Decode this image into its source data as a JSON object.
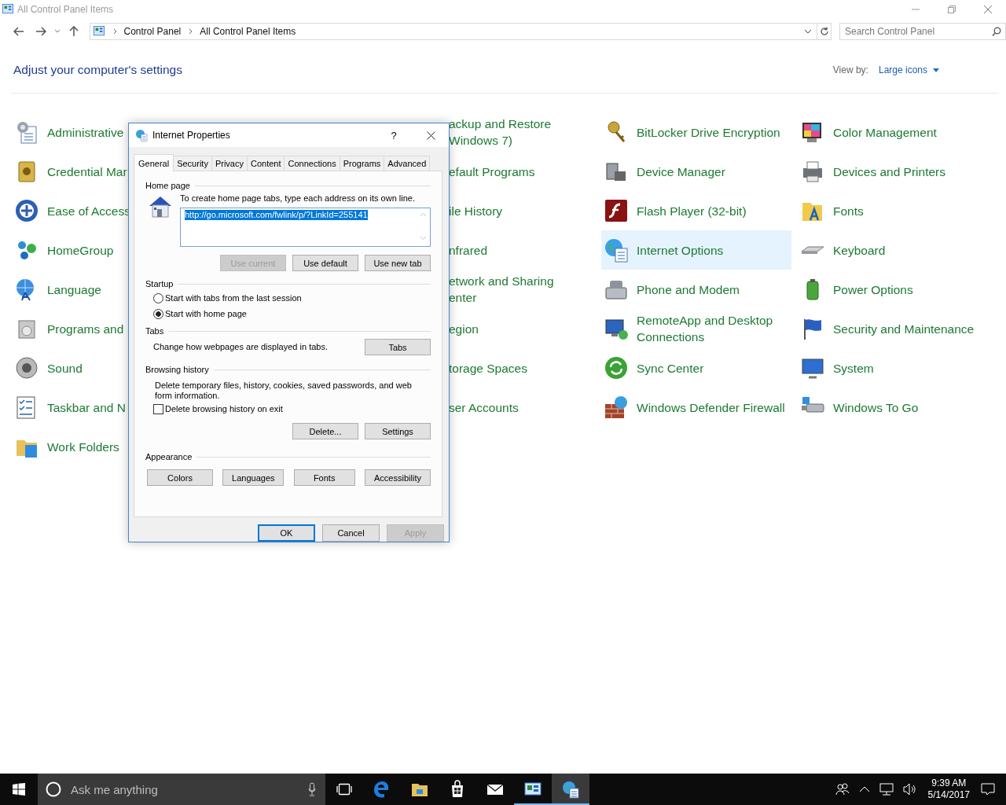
{
  "window": {
    "title": "All Control Panel Items"
  },
  "address": {
    "path": [
      "Control Panel",
      "All Control Panel Items"
    ]
  },
  "search": {
    "placeholder": "Search Control Panel"
  },
  "heading": "Adjust your computer's settings",
  "view_by": {
    "label": "View by:",
    "value": "Large icons"
  },
  "columns": [
    {
      "items": [
        {
          "label": "Administrative",
          "selected": false
        },
        {
          "label": "Credential Mar",
          "selected": false
        },
        {
          "label": "Ease of Access",
          "selected": false
        },
        {
          "label": "HomeGroup",
          "selected": false
        },
        {
          "label": "Language",
          "selected": false
        },
        {
          "label": "Programs and",
          "selected": false
        },
        {
          "label": "Sound",
          "selected": false
        },
        {
          "label": "Taskbar and N",
          "selected": false
        },
        {
          "label": "Work Folders",
          "selected": false
        }
      ]
    },
    {
      "items": [
        {
          "label": "ackup and Restore Windows 7)",
          "selected": false
        },
        {
          "label": "efault Programs",
          "selected": false
        },
        {
          "label": "ile History",
          "selected": false
        },
        {
          "label": "nfrared",
          "selected": false
        },
        {
          "label": "etwork and Sharing enter",
          "selected": false
        },
        {
          "label": "egion",
          "selected": false
        },
        {
          "label": "torage Spaces",
          "selected": false
        },
        {
          "label": "ser Accounts",
          "selected": false
        }
      ]
    },
    {
      "items": [
        {
          "label": "BitLocker Drive Encryption",
          "selected": false
        },
        {
          "label": "Device Manager",
          "selected": false
        },
        {
          "label": "Flash Player (32-bit)",
          "selected": false
        },
        {
          "label": "Internet Options",
          "selected": true
        },
        {
          "label": "Phone and Modem",
          "selected": false
        },
        {
          "label": "RemoteApp and Desktop Connections",
          "selected": false
        },
        {
          "label": "Sync Center",
          "selected": false
        },
        {
          "label": "Windows Defender Firewall",
          "selected": false
        }
      ]
    },
    {
      "items": [
        {
          "label": "Color Management",
          "selected": false
        },
        {
          "label": "Devices and Printers",
          "selected": false
        },
        {
          "label": "Fonts",
          "selected": false
        },
        {
          "label": "Keyboard",
          "selected": false
        },
        {
          "label": "Power Options",
          "selected": false
        },
        {
          "label": "Security and Maintenance",
          "selected": false
        },
        {
          "label": "System",
          "selected": false
        },
        {
          "label": "Windows To Go",
          "selected": false
        }
      ]
    }
  ],
  "dialog": {
    "title": "Internet Properties",
    "help": "?",
    "tabs": [
      {
        "label": "General",
        "selected": true
      },
      {
        "label": "Security",
        "selected": false
      },
      {
        "label": "Privacy",
        "selected": false
      },
      {
        "label": "Content",
        "selected": false
      },
      {
        "label": "Connections",
        "selected": false
      },
      {
        "label": "Programs",
        "selected": false
      },
      {
        "label": "Advanced",
        "selected": false
      }
    ],
    "home_page": {
      "heading": "Home page",
      "hint": "To create home page tabs, type each address on its own line.",
      "value": "http://go.microsoft.com/fwlink/p/?LinkId=255141",
      "value_selected": true,
      "buttons": [
        {
          "label": "Use current",
          "disabled": true
        },
        {
          "label": "Use default",
          "disabled": false
        },
        {
          "label": "Use new tab",
          "disabled": false
        }
      ]
    },
    "startup": {
      "heading": "Startup",
      "options": [
        {
          "label": "Start with tabs from the last session",
          "selected": false
        },
        {
          "label": "Start with home page",
          "selected": true
        }
      ]
    },
    "tabs_group": {
      "heading": "Tabs",
      "text": "Change how webpages are displayed in tabs.",
      "button": "Tabs"
    },
    "browsing_history": {
      "heading": "Browsing history",
      "text": "Delete temporary files, history, cookies, saved passwords, and web form information.",
      "checkbox": {
        "label": "Delete browsing history on exit",
        "checked": false
      },
      "buttons": [
        "Delete...",
        "Settings"
      ]
    },
    "appearance": {
      "heading": "Appearance",
      "buttons": [
        "Colors",
        "Languages",
        "Fonts",
        "Accessibility"
      ]
    },
    "footer": [
      {
        "label": "OK",
        "default": true,
        "disabled": false
      },
      {
        "label": "Cancel",
        "default": false,
        "disabled": false
      },
      {
        "label": "Apply",
        "default": false,
        "disabled": true
      }
    ]
  },
  "taskbar": {
    "search_placeholder": "Ask me anything",
    "apps": [
      {
        "running": false,
        "active": false
      },
      {
        "running": false,
        "active": false
      },
      {
        "running": false,
        "active": false
      },
      {
        "running": false,
        "active": false
      },
      {
        "running": true,
        "active": false
      },
      {
        "running": true,
        "active": true
      }
    ],
    "time": "9:39 AM",
    "date": "5/14/2017"
  }
}
